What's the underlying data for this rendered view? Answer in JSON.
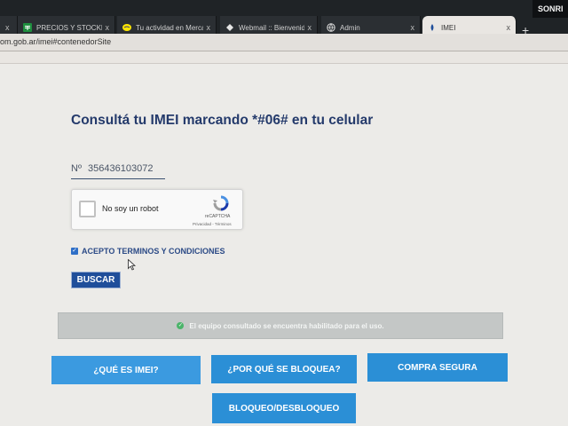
{
  "browser": {
    "tabs": [
      {
        "icon": "sheets-icon",
        "label": "PRECIOS Y STOCKDE",
        "active": false
      },
      {
        "icon": "mercadolibre-icon",
        "label": "Tu actividad en Merca",
        "active": false
      },
      {
        "icon": "webmail-icon",
        "label": "Webmail :: Bienvenido",
        "active": false
      },
      {
        "icon": "globe-icon",
        "label": "Admin",
        "active": false
      },
      {
        "icon": "enacom-icon",
        "label": "IMEI",
        "active": true
      }
    ],
    "close_glyph": "x",
    "new_tab_glyph": "+",
    "profile_label": "SONRI",
    "url": "om.gob.ar/imei#contenedorSite"
  },
  "page": {
    "heading": "Consultá tu IMEI marcando *#06# en tu celular",
    "imei_prefix": "Nº",
    "imei_value": "356436103072",
    "recaptcha": {
      "label": "No soy un robot",
      "brand": "reCAPTCHA",
      "links": "Privacidad - Términos"
    },
    "terms_label": "ACEPTO TERMINOS Y CONDICIONES",
    "terms_checked": true,
    "search_button": "BUSCAR",
    "result_message": "El equipo consultado se encuentra habilitado para el uso.",
    "nav_buttons": {
      "que_es": "¿QUÉ ES IMEI?",
      "por_que": "¿POR QUÉ SE BLOQUEA?",
      "compra": "COMPRA SEGURA",
      "bloqueo": "BLOQUEO/DESBLOQUEO"
    }
  },
  "colors": {
    "heading": "#243a6b",
    "primary_button": "#1f4e9a",
    "nav_button": "#2b8fd6",
    "success": "#4bb46a",
    "result_bg": "#c4c7c6"
  }
}
